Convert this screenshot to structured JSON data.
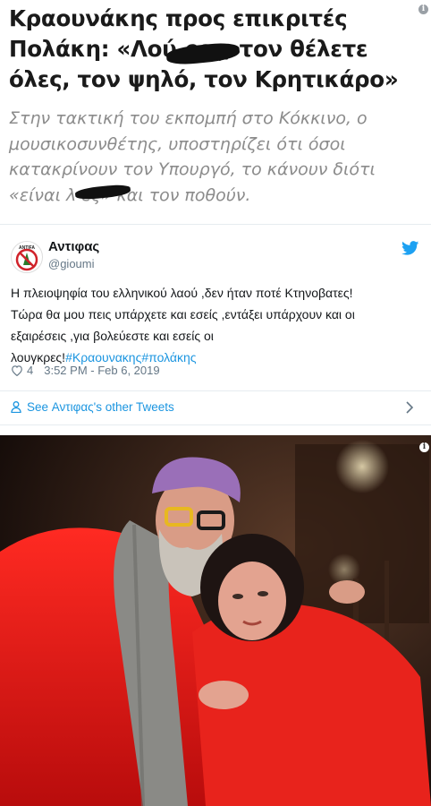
{
  "article": {
    "headline_lines": [
      "Κραουνάκης προς επικριτές",
      "Πολάκη: «Λού    ρες, τον θέλετε",
      "όλες, τον ψηλό, τον Κρητικάρο»"
    ],
    "subhead_lines": [
      "Στην τακτική του εκπομπή στο Κόκκινο, ο",
      "μουσικοσυνθέτης, υποστηρίζει ότι όσοι",
      "κατακρίνουν τον Υπουργό, το κάνουν διότι",
      "«είναι λ        ες» και τον ποθούν."
    ],
    "info_icon": "info-icon"
  },
  "tweet": {
    "avatar_label": "ANTIFA",
    "author_name": "Αντιφας",
    "author_handle": "@gioumi",
    "text_lines": [
      "Η πλειοψηφία του ελληνικού λαού ,δεν ήταν ποτέ Κτηνοβατες!",
      "Τώρα θα μου πεις υπάρχετε και εσείς ,εντάξει υπάρχουν και οι",
      "εξαιρέσεις  ,για βολεύεστε και εσείς οι"
    ],
    "last_line_text": "λουγκρες!",
    "hashtags": [
      "#Κραουνακης",
      "#πολάκης"
    ],
    "likes": "4",
    "timestamp": "3:52 PM - Feb 6, 2019",
    "see_other_label": "See Αντιφας's other Tweets",
    "brand_color": "#1da1f2",
    "link_color": "#1b95e0"
  },
  "photo": {
    "info_icon": "info-icon"
  }
}
